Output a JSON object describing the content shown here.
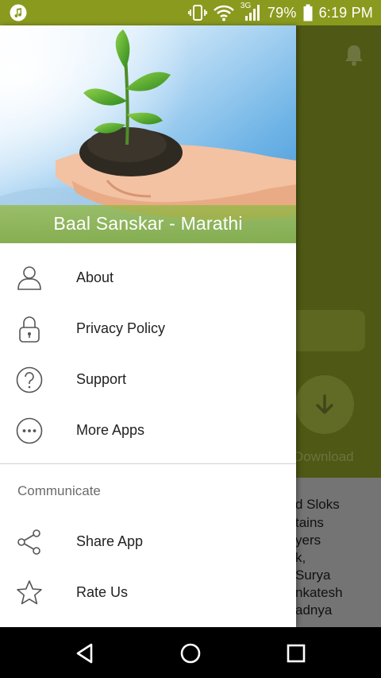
{
  "status_bar": {
    "battery_percent": "79%",
    "time": "6:19 PM",
    "network": "3G",
    "background": "#8a9a1e",
    "icons": [
      "music-app-icon",
      "vibrate-icon",
      "wifi-icon",
      "signal-icon",
      "battery-icon"
    ]
  },
  "drawer": {
    "header_title": "Baal Sanskar - Marathi",
    "menu_items": [
      {
        "label": "About",
        "icon": "person-icon"
      },
      {
        "label": "Privacy Policy",
        "icon": "lock-icon"
      },
      {
        "label": "Support",
        "icon": "help-icon"
      },
      {
        "label": "More Apps",
        "icon": "more-horizontal-icon"
      }
    ],
    "section_label": "Communicate",
    "communicate_items": [
      {
        "label": "Share App",
        "icon": "share-icon"
      },
      {
        "label": "Rate Us",
        "icon": "star-icon"
      }
    ]
  },
  "background_app": {
    "download_label": "Download",
    "content_lines": [
      "d Sloks",
      "tains",
      "yers",
      "k,",
      "Surya",
      "nkatesh",
      "adnya"
    ],
    "accent": "#4f5814"
  },
  "nav_bar": {
    "icons": [
      "back-icon",
      "home-icon",
      "recents-icon"
    ]
  }
}
